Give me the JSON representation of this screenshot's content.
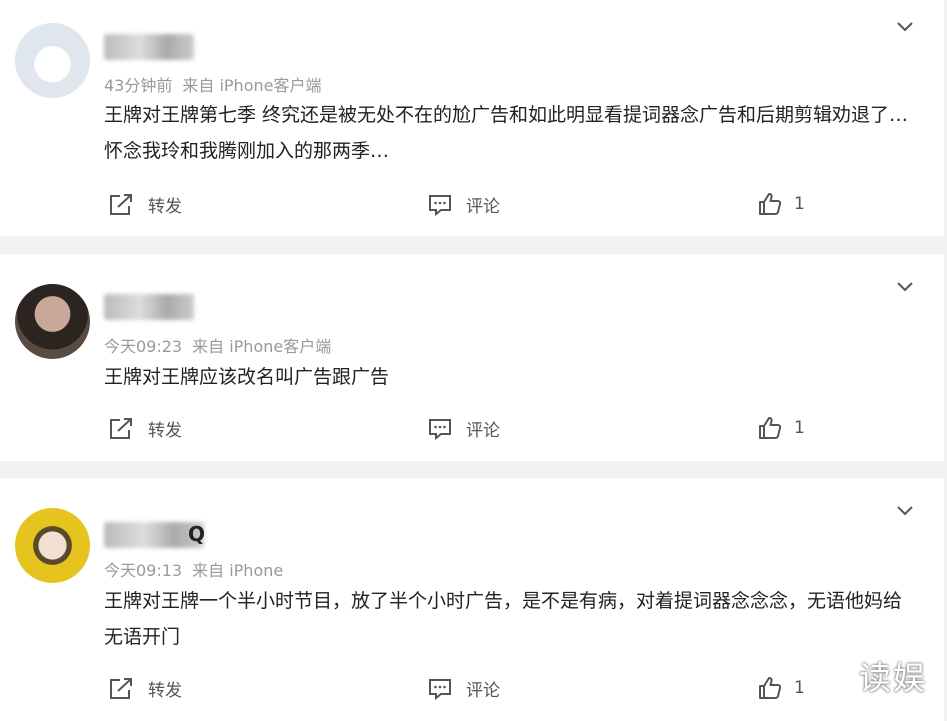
{
  "comments": [
    {
      "meta_time": "43分钟前",
      "meta_source": "来自 iPhone客户端",
      "text": "王牌对王牌第七季 终究还是被无处不在的尬广告和如此明显看提词器念广告和后期剪辑劝退了…怀念我玲和我腾刚加入的那两季…",
      "forward_label": "转发",
      "comment_label": "评论",
      "like_count": "1"
    },
    {
      "meta_time": "今天09:23",
      "meta_source": "来自 iPhone客户端",
      "text": "王牌对王牌应该改名叫广告跟广告",
      "forward_label": "转发",
      "comment_label": "评论",
      "like_count": "1"
    },
    {
      "name_tail": "Q",
      "meta_time": "今天09:13",
      "meta_source": "来自 iPhone",
      "text": "王牌对王牌一个半小时节目，放了半个小时广告，是不是有病，对着提词器念念念，无语他妈给无语开门",
      "forward_label": "转发",
      "comment_label": "评论",
      "like_count": "1"
    }
  ],
  "watermark": "读娱"
}
